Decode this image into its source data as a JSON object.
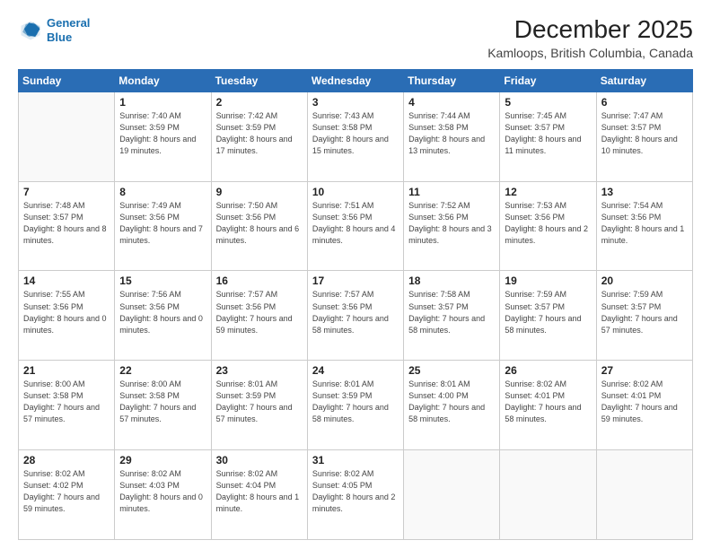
{
  "header": {
    "logo_line1": "General",
    "logo_line2": "Blue",
    "month": "December 2025",
    "location": "Kamloops, British Columbia, Canada"
  },
  "weekdays": [
    "Sunday",
    "Monday",
    "Tuesday",
    "Wednesday",
    "Thursday",
    "Friday",
    "Saturday"
  ],
  "weeks": [
    [
      {
        "day": "",
        "sunrise": "",
        "sunset": "",
        "daylight": ""
      },
      {
        "day": "1",
        "sunrise": "Sunrise: 7:40 AM",
        "sunset": "Sunset: 3:59 PM",
        "daylight": "Daylight: 8 hours and 19 minutes."
      },
      {
        "day": "2",
        "sunrise": "Sunrise: 7:42 AM",
        "sunset": "Sunset: 3:59 PM",
        "daylight": "Daylight: 8 hours and 17 minutes."
      },
      {
        "day": "3",
        "sunrise": "Sunrise: 7:43 AM",
        "sunset": "Sunset: 3:58 PM",
        "daylight": "Daylight: 8 hours and 15 minutes."
      },
      {
        "day": "4",
        "sunrise": "Sunrise: 7:44 AM",
        "sunset": "Sunset: 3:58 PM",
        "daylight": "Daylight: 8 hours and 13 minutes."
      },
      {
        "day": "5",
        "sunrise": "Sunrise: 7:45 AM",
        "sunset": "Sunset: 3:57 PM",
        "daylight": "Daylight: 8 hours and 11 minutes."
      },
      {
        "day": "6",
        "sunrise": "Sunrise: 7:47 AM",
        "sunset": "Sunset: 3:57 PM",
        "daylight": "Daylight: 8 hours and 10 minutes."
      }
    ],
    [
      {
        "day": "7",
        "sunrise": "Sunrise: 7:48 AM",
        "sunset": "Sunset: 3:57 PM",
        "daylight": "Daylight: 8 hours and 8 minutes."
      },
      {
        "day": "8",
        "sunrise": "Sunrise: 7:49 AM",
        "sunset": "Sunset: 3:56 PM",
        "daylight": "Daylight: 8 hours and 7 minutes."
      },
      {
        "day": "9",
        "sunrise": "Sunrise: 7:50 AM",
        "sunset": "Sunset: 3:56 PM",
        "daylight": "Daylight: 8 hours and 6 minutes."
      },
      {
        "day": "10",
        "sunrise": "Sunrise: 7:51 AM",
        "sunset": "Sunset: 3:56 PM",
        "daylight": "Daylight: 8 hours and 4 minutes."
      },
      {
        "day": "11",
        "sunrise": "Sunrise: 7:52 AM",
        "sunset": "Sunset: 3:56 PM",
        "daylight": "Daylight: 8 hours and 3 minutes."
      },
      {
        "day": "12",
        "sunrise": "Sunrise: 7:53 AM",
        "sunset": "Sunset: 3:56 PM",
        "daylight": "Daylight: 8 hours and 2 minutes."
      },
      {
        "day": "13",
        "sunrise": "Sunrise: 7:54 AM",
        "sunset": "Sunset: 3:56 PM",
        "daylight": "Daylight: 8 hours and 1 minute."
      }
    ],
    [
      {
        "day": "14",
        "sunrise": "Sunrise: 7:55 AM",
        "sunset": "Sunset: 3:56 PM",
        "daylight": "Daylight: 8 hours and 0 minutes."
      },
      {
        "day": "15",
        "sunrise": "Sunrise: 7:56 AM",
        "sunset": "Sunset: 3:56 PM",
        "daylight": "Daylight: 8 hours and 0 minutes."
      },
      {
        "day": "16",
        "sunrise": "Sunrise: 7:57 AM",
        "sunset": "Sunset: 3:56 PM",
        "daylight": "Daylight: 7 hours and 59 minutes."
      },
      {
        "day": "17",
        "sunrise": "Sunrise: 7:57 AM",
        "sunset": "Sunset: 3:56 PM",
        "daylight": "Daylight: 7 hours and 58 minutes."
      },
      {
        "day": "18",
        "sunrise": "Sunrise: 7:58 AM",
        "sunset": "Sunset: 3:57 PM",
        "daylight": "Daylight: 7 hours and 58 minutes."
      },
      {
        "day": "19",
        "sunrise": "Sunrise: 7:59 AM",
        "sunset": "Sunset: 3:57 PM",
        "daylight": "Daylight: 7 hours and 58 minutes."
      },
      {
        "day": "20",
        "sunrise": "Sunrise: 7:59 AM",
        "sunset": "Sunset: 3:57 PM",
        "daylight": "Daylight: 7 hours and 57 minutes."
      }
    ],
    [
      {
        "day": "21",
        "sunrise": "Sunrise: 8:00 AM",
        "sunset": "Sunset: 3:58 PM",
        "daylight": "Daylight: 7 hours and 57 minutes."
      },
      {
        "day": "22",
        "sunrise": "Sunrise: 8:00 AM",
        "sunset": "Sunset: 3:58 PM",
        "daylight": "Daylight: 7 hours and 57 minutes."
      },
      {
        "day": "23",
        "sunrise": "Sunrise: 8:01 AM",
        "sunset": "Sunset: 3:59 PM",
        "daylight": "Daylight: 7 hours and 57 minutes."
      },
      {
        "day": "24",
        "sunrise": "Sunrise: 8:01 AM",
        "sunset": "Sunset: 3:59 PM",
        "daylight": "Daylight: 7 hours and 58 minutes."
      },
      {
        "day": "25",
        "sunrise": "Sunrise: 8:01 AM",
        "sunset": "Sunset: 4:00 PM",
        "daylight": "Daylight: 7 hours and 58 minutes."
      },
      {
        "day": "26",
        "sunrise": "Sunrise: 8:02 AM",
        "sunset": "Sunset: 4:01 PM",
        "daylight": "Daylight: 7 hours and 58 minutes."
      },
      {
        "day": "27",
        "sunrise": "Sunrise: 8:02 AM",
        "sunset": "Sunset: 4:01 PM",
        "daylight": "Daylight: 7 hours and 59 minutes."
      }
    ],
    [
      {
        "day": "28",
        "sunrise": "Sunrise: 8:02 AM",
        "sunset": "Sunset: 4:02 PM",
        "daylight": "Daylight: 7 hours and 59 minutes."
      },
      {
        "day": "29",
        "sunrise": "Sunrise: 8:02 AM",
        "sunset": "Sunset: 4:03 PM",
        "daylight": "Daylight: 8 hours and 0 minutes."
      },
      {
        "day": "30",
        "sunrise": "Sunrise: 8:02 AM",
        "sunset": "Sunset: 4:04 PM",
        "daylight": "Daylight: 8 hours and 1 minute."
      },
      {
        "day": "31",
        "sunrise": "Sunrise: 8:02 AM",
        "sunset": "Sunset: 4:05 PM",
        "daylight": "Daylight: 8 hours and 2 minutes."
      },
      {
        "day": "",
        "sunrise": "",
        "sunset": "",
        "daylight": ""
      },
      {
        "day": "",
        "sunrise": "",
        "sunset": "",
        "daylight": ""
      },
      {
        "day": "",
        "sunrise": "",
        "sunset": "",
        "daylight": ""
      }
    ]
  ]
}
